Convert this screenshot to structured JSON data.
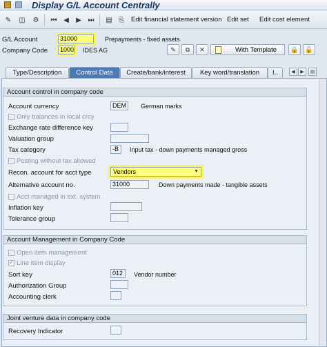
{
  "window": {
    "title": "Display G/L Account Centrally"
  },
  "toolbar": {
    "edit_fs_version": "Edit financial statement version",
    "edit_set": "Edit set",
    "edit_cost_element": "Edit cost element"
  },
  "header": {
    "gl_account_label": "G/L Account",
    "gl_account_value": "31000",
    "gl_account_desc": "Prepayments - fixed assets",
    "company_code_label": "Company Code",
    "company_code_value": "1000",
    "company_code_desc": "IDES AG",
    "with_template": "With Template"
  },
  "tabs": [
    {
      "label": "Type/Description",
      "active": false
    },
    {
      "label": "Control Data",
      "active": true
    },
    {
      "label": "Create/bank/interest",
      "active": false
    },
    {
      "label": "Key word/translation",
      "active": false
    },
    {
      "label": "I..",
      "active": false
    }
  ],
  "account_control": {
    "title": "Account control in company code",
    "account_currency_label": "Account currency",
    "account_currency_value": "DEM",
    "account_currency_desc": "German marks",
    "only_balances_label": "Only balances in local crcy",
    "exchange_rate_label": "Exchange rate difference key",
    "valuation_group_label": "Valuation group",
    "tax_category_label": "Tax category",
    "tax_category_value": "-B",
    "tax_category_desc": "Input tax - down payments managed gross",
    "posting_without_tax_label": "Posting without tax allowed",
    "recon_label": "Recon. account for acct type",
    "recon_value": "Vendors",
    "alt_account_label": "Alternative account no.",
    "alt_account_value": "31000",
    "alt_account_desc": "Down payments made - tangible assets",
    "acct_ext_label": "Acct managed in ext. system",
    "inflation_key_label": "Inflation key",
    "tolerance_group_label": "Tolerance group"
  },
  "account_mgmt": {
    "title": "Account Management in Company Code",
    "open_item_label": "Open item management",
    "line_item_label": "Line item display",
    "sort_key_label": "Sort key",
    "sort_key_value": "012",
    "sort_key_desc": "Vendor number",
    "auth_group_label": "Authorization Group",
    "accounting_clerk_label": "Accounting clerk"
  },
  "joint_venture": {
    "title": "Joint venture data in company code",
    "recovery_indicator_label": "Recovery Indicator"
  },
  "colors": {
    "highlight": "#fffe7a",
    "active_tab": "#4e7ab2",
    "title_text": "#17335b"
  }
}
